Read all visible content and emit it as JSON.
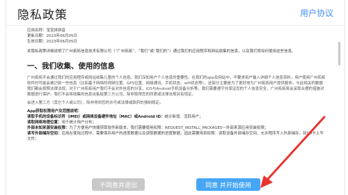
{
  "header": {
    "title": "隐私政策",
    "user_agreement_link": "用户协议"
  },
  "meta": {
    "app_name": "应用名称：宝宝拼拼音",
    "update_date": "更新日期：2023年06月05日",
    "effective_date": "生效日期：2023年06月05日"
  },
  "intro": "本隐私政策详细说明了广州拓拓信息技术有限公司（“广州拓拓”、“我们”或“我们的”）通过我们的应用程序和网站收集的信息，以及我们将如何使用这些信息。",
  "section1": {
    "title": "一、我们收集、使用的信息",
    "para1": "广州拓拓不会通过我们的应用程序或网站收集儿童的个人信息。我们深知用户个人信息的重要性。在我们的app及网站中，不要求用户输入详细个人信息资料，用户使用广州拓拓软件时可能会被识别一些信息（比如基于网络的视频位置、GPS位置、网络通讯、手机状态、wifi状态等），这部分主要是为了更好地为广州拓拓用户提供服务。与此相关的数据我们都会按照法律法规，对于广州拓拓用户我们不会对外信息的分享，iOS与Android手机设备分析等。我们需要遵守并保证您的个人信息安全，广州拓拓将会采取合理的措施对数据进行保护。我们不会将收集的信息出售给第三方公司，除非取得您的同意或法律法规另有规定。",
    "para2": "会进入第三方（其它个人或公司），除非得到您的许可或法律或政府的强制规定。"
  },
  "permissions": {
    "heading": "App获取权限用户及范围说明：",
    "rows": [
      {
        "name": "读取手机的设备标识符（IMEI）或网络设备硬件地址（MAC）或Android ID：",
        "desc": "统计新增、活跃用户；"
      },
      {
        "name": "读取网络地理位置：",
        "desc": "用于统计用户分布；"
      },
      {
        "name": "外部未知来源安装权限：",
        "desc": "为了方便用户快捷获取软件新版本，我们需要使用权限：REQUEST_INSTALL_PACKAGES一外部来源应用安装权限；"
      },
      {
        "name": "读写外部储存空间：",
        "desc": "应用在使用过程中，需要保存用户的进度数据以及读取数据的进度数据，因此需要用到权限：读取设备外部储存空间、允许程序写入外部储存，如SD卡上写文件；"
      }
    ]
  },
  "buttons": {
    "disagree": "不同意并退出",
    "agree": "同意 并开始使用"
  },
  "colors": {
    "accent": "#3f8ef5",
    "agree_button": "#46a6f5",
    "disagree_button": "#c8c8c8",
    "annotation_arrow": "#e8342e"
  }
}
